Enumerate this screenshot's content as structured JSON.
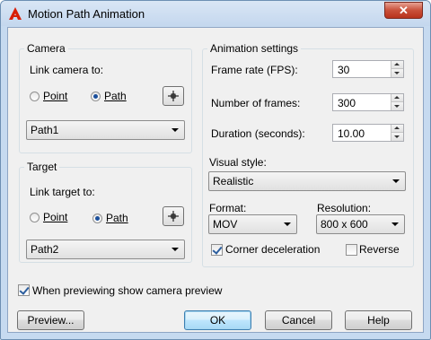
{
  "window": {
    "title": "Motion Path Animation",
    "close_label": "✕",
    "icon": "autocad-a-icon",
    "accent": "#d81e05"
  },
  "camera": {
    "group_label": "Camera",
    "link_label": "Link camera to:",
    "point_label": "Point",
    "path_label": "Path",
    "selected": "path",
    "pick_icon": "crosshair-pick-icon",
    "path_value": "Path1"
  },
  "target": {
    "group_label": "Target",
    "link_label": "Link target to:",
    "point_label": "Point",
    "path_label": "Path",
    "selected": "path",
    "pick_icon": "crosshair-pick-icon",
    "path_value": "Path2"
  },
  "animation": {
    "group_label": "Animation settings",
    "frame_rate_label": "Frame rate (FPS):",
    "frame_rate_value": "30",
    "frames_label": "Number of frames:",
    "frames_value": "300",
    "duration_label": "Duration (seconds):",
    "duration_value": "10.00",
    "visual_style_label": "Visual style:",
    "visual_style_value": "Realistic",
    "format_label": "Format:",
    "format_value": "MOV",
    "resolution_label": "Resolution:",
    "resolution_value": "800 x 600",
    "corner_decel_label": "Corner deceleration",
    "corner_decel_checked": true,
    "reverse_label": "Reverse",
    "reverse_checked": false
  },
  "preview_checkbox": {
    "label": "When previewing show camera preview",
    "checked": true
  },
  "buttons": {
    "preview": "Preview...",
    "ok": "OK",
    "cancel": "Cancel",
    "help": "Help"
  }
}
